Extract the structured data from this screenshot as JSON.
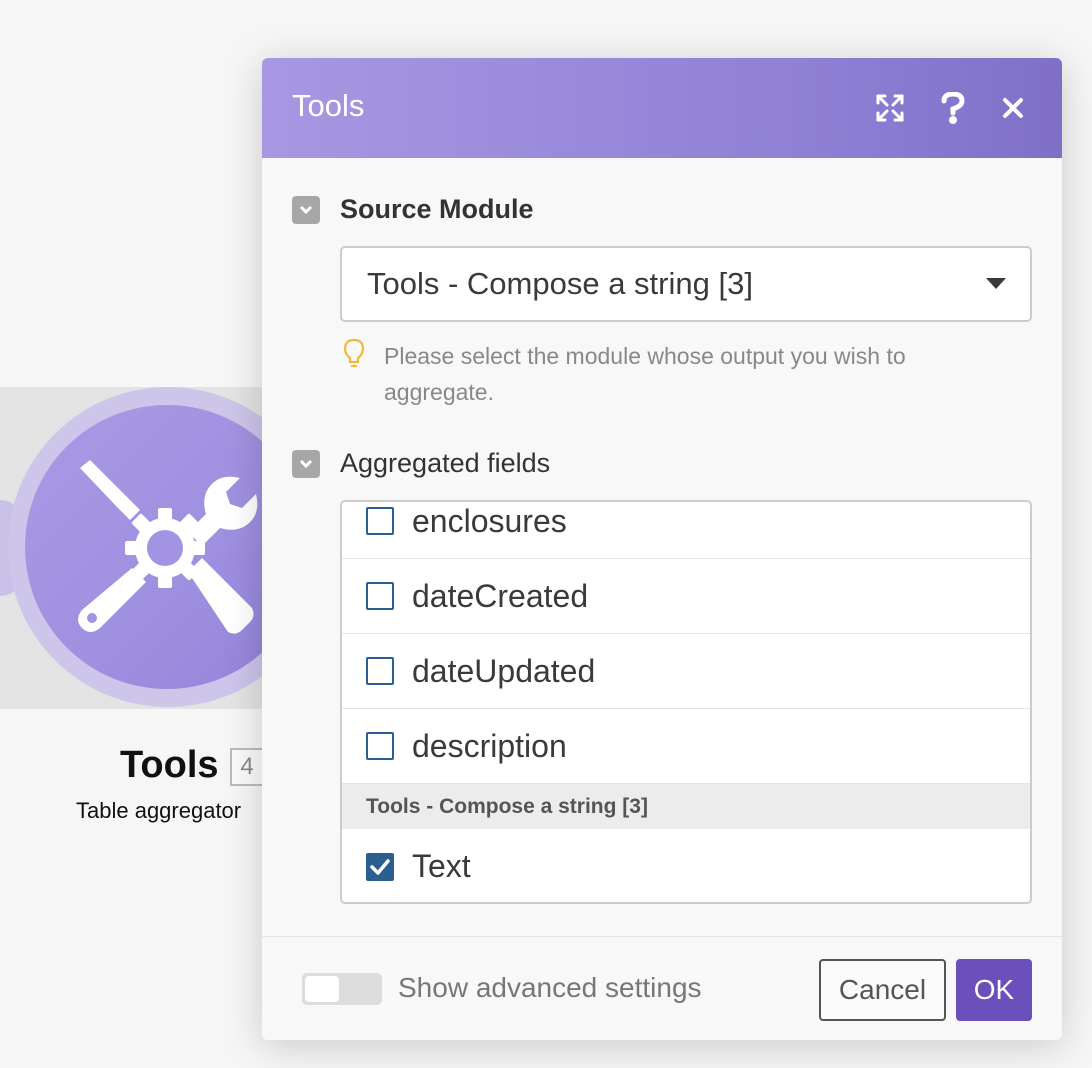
{
  "canvas": {
    "module": {
      "title": "Tools",
      "badge": "4",
      "subtitle": "Table aggregator",
      "icon": "tools-wrench-screwdriver-icon",
      "color": "#a294e2"
    }
  },
  "dialog": {
    "title": "Tools",
    "header_color": "#8f7fd6",
    "header_buttons": [
      "expand-icon",
      "help-icon",
      "close-icon"
    ],
    "source_module": {
      "label": "Source Module",
      "selected": "Tools - Compose a string [3]",
      "hint": "Please select the module whose output you wish to aggregate."
    },
    "aggregated_fields": {
      "label": "Aggregated fields",
      "fields": [
        {
          "label": "enclosures",
          "checked": false
        },
        {
          "label": "dateCreated",
          "checked": false
        },
        {
          "label": "dateUpdated",
          "checked": false
        },
        {
          "label": "description",
          "checked": false
        }
      ],
      "group_header": "Tools - Compose a string [3]",
      "group_fields": [
        {
          "label": "Text",
          "checked": true
        }
      ]
    },
    "footer": {
      "advanced_label": "Show advanced settings",
      "advanced_enabled": false,
      "cancel_label": "Cancel",
      "ok_label": "OK",
      "ok_color": "#6b4fbb"
    }
  }
}
